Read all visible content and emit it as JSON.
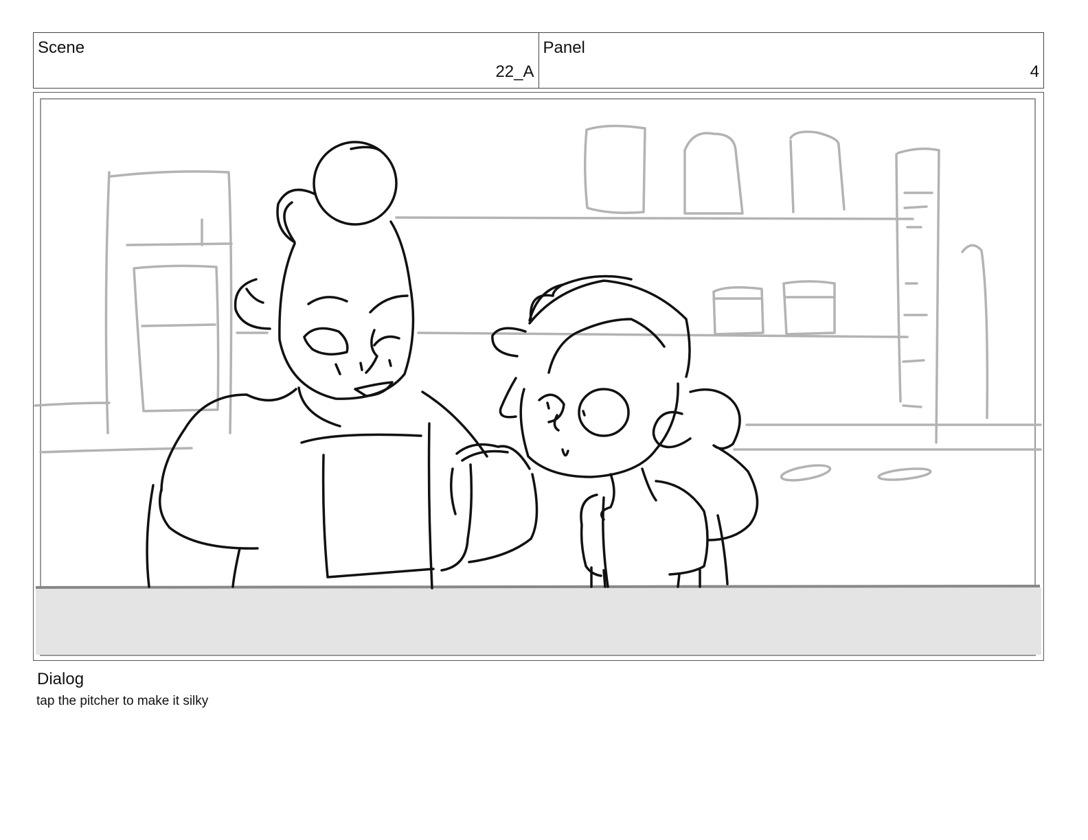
{
  "header": {
    "scene_label": "Scene",
    "scene_value": "22_A",
    "panel_label": "Panel",
    "panel_value": "4"
  },
  "dialog": {
    "label": "Dialog",
    "text": "tap the pitcher to make it silky"
  }
}
